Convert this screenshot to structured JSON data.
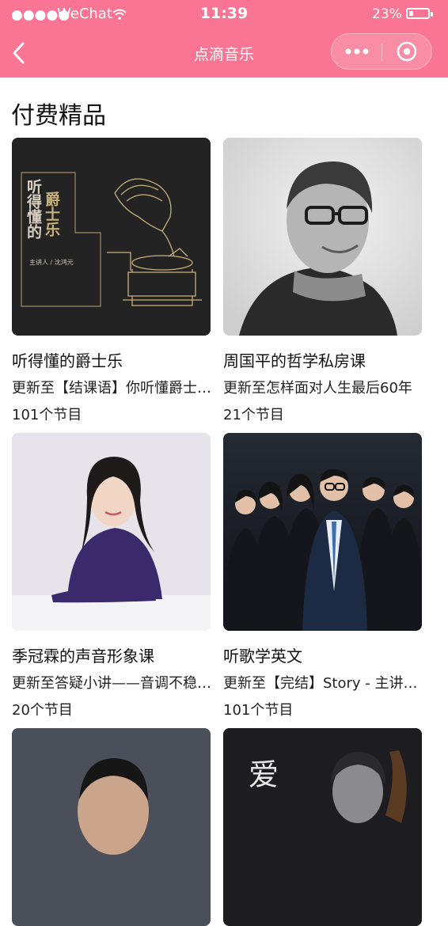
{
  "status_bar": {
    "signal": "●●●●●",
    "carrier": "WeChat",
    "time": "11:39",
    "battery_percent": "23%"
  },
  "nav": {
    "title": "点滴音乐",
    "more_label": "•••"
  },
  "section": {
    "title": "付费精品"
  },
  "courses": [
    {
      "title": "听得懂的爵士乐",
      "subtitle": "更新至【结课语】你听懂爵士乐了吗？",
      "count": "101个节目",
      "cover": {
        "title_right": "爵士乐",
        "title_left": "听得懂的",
        "credit": "主讲人 / 沈鸿元"
      }
    },
    {
      "title": "周国平的哲学私房课",
      "subtitle": "更新至怎样面对人生最后60年",
      "count": "21个节目"
    },
    {
      "title": "季冠霖的声音形象课",
      "subtitle": "更新至答疑小讲——音调不稳怎么办",
      "count": "20个节目"
    },
    {
      "title": "听歌学英文",
      "subtitle": "更新至【完结】Story - 主讲人寄语",
      "count": "101个节目"
    },
    {
      "title": "",
      "subtitle": "",
      "count": ""
    },
    {
      "title": "",
      "subtitle": "",
      "count": "",
      "cover": {
        "text": "爱"
      }
    }
  ],
  "colors": {
    "brand": "#f97593",
    "cover_dark": "#222222",
    "cover_gold": "#c8b07a"
  }
}
